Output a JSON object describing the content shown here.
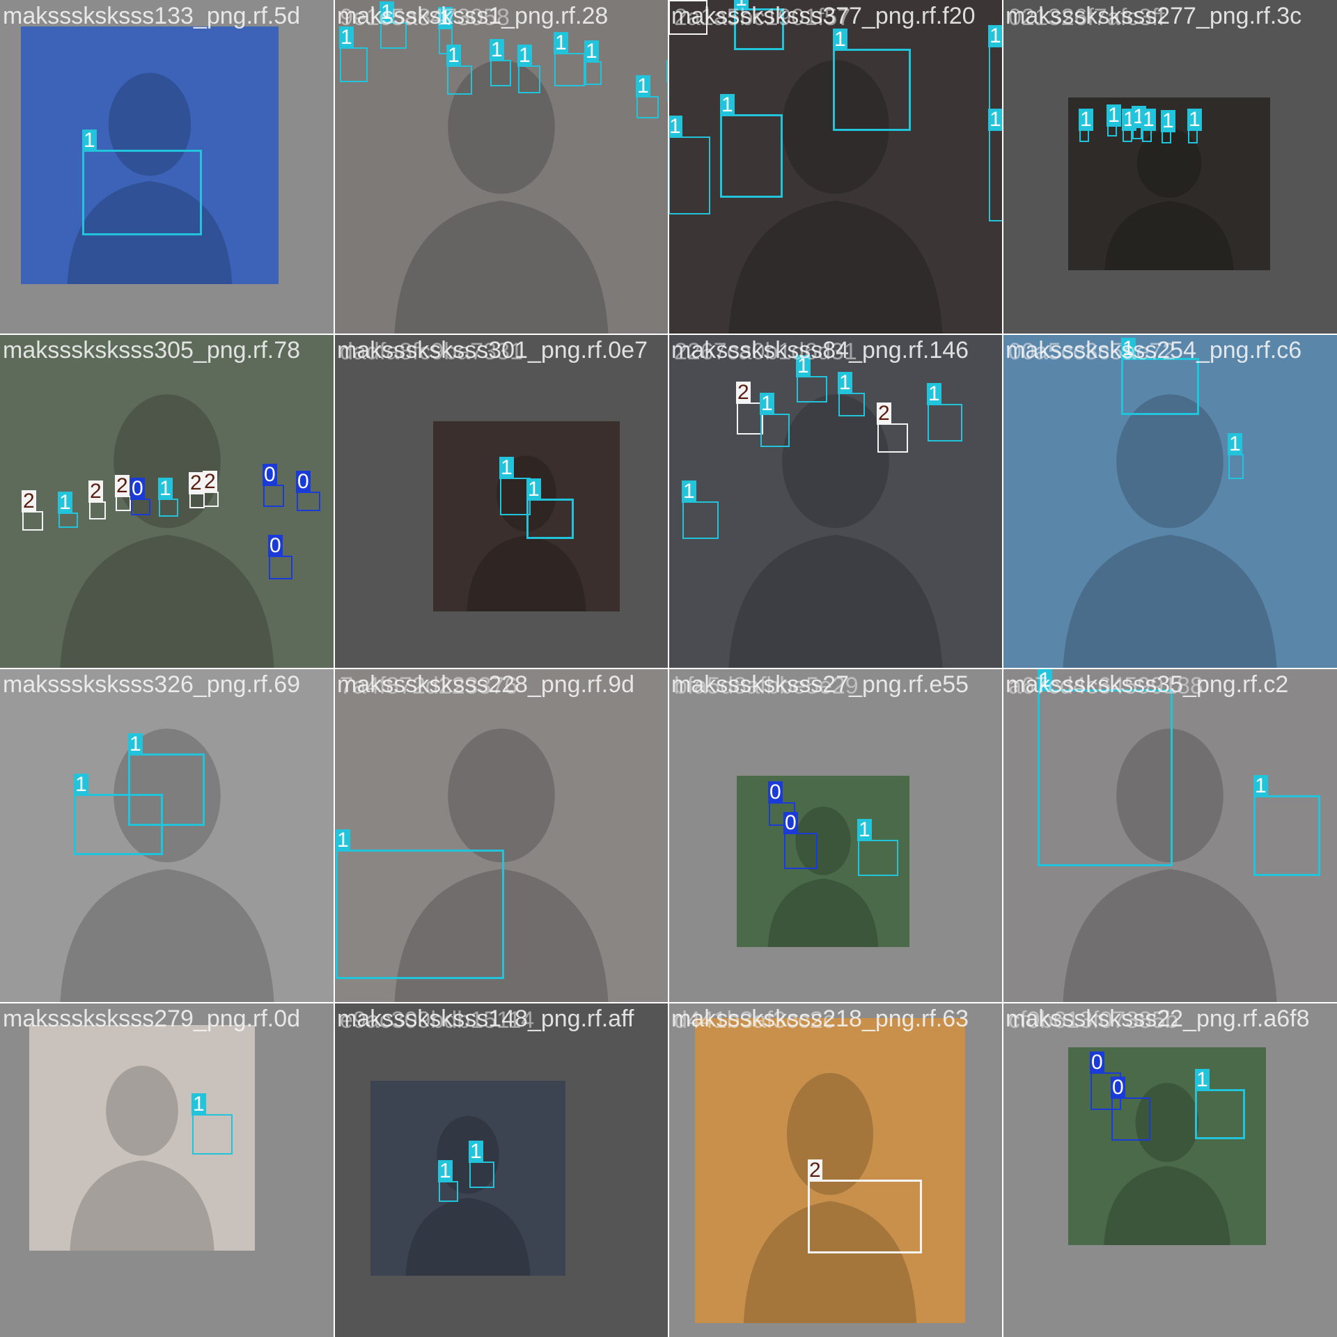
{
  "class_colors": {
    "0": "#1a3bd8",
    "1": "#22c4dc",
    "2": "#f4f4f4"
  },
  "tiles": [
    {
      "label": "maksssksksss133_png.rf.5d",
      "label2": "",
      "bg": "#8c8c8c",
      "photo": "#3c63b8",
      "boxes": [
        {
          "cls": "1"
        }
      ]
    },
    {
      "label": "maksssksksss1_png.rf.28",
      "label2": "9e1c5a8473058",
      "bg": "#6a6a6a",
      "photo": "#7d7a78",
      "boxes": [
        {
          "cls": "1"
        },
        {
          "cls": "1"
        },
        {
          "cls": "1"
        },
        {
          "cls": "1"
        },
        {
          "cls": "1"
        },
        {
          "cls": "1"
        },
        {
          "cls": "1"
        },
        {
          "cls": "1"
        },
        {
          "cls": "1"
        },
        {
          "cls": "1"
        }
      ]
    },
    {
      "label": "maksssksksss377_png.rf.f20",
      "label2": "2a1a5bc1901f57",
      "bg": "#2a2a2a",
      "photo": "#3b3535",
      "boxes": [
        {
          "cls": "2"
        },
        {
          "cls": "1"
        },
        {
          "cls": "1"
        },
        {
          "cls": "1"
        },
        {
          "cls": "1"
        },
        {
          "cls": "1"
        },
        {
          "cls": "1"
        }
      ]
    },
    {
      "label": "maksssksksss277_png.rf.3c",
      "label2": "021326f7afc3ff",
      "bg": "#555555",
      "photo": "#2e2b28",
      "boxes": [
        {
          "cls": "1"
        },
        {
          "cls": "1"
        },
        {
          "cls": "1"
        },
        {
          "cls": "1"
        },
        {
          "cls": "1"
        },
        {
          "cls": "1"
        },
        {
          "cls": "1"
        }
      ]
    },
    {
      "label": "maksssksksss305_png.rf.78",
      "label2": "",
      "bg": "#5a6458",
      "photo": "#5e6a5a",
      "boxes": [
        {
          "cls": "2"
        },
        {
          "cls": "1"
        },
        {
          "cls": "2"
        },
        {
          "cls": "2"
        },
        {
          "cls": "0"
        },
        {
          "cls": "1"
        },
        {
          "cls": "2"
        },
        {
          "cls": "2"
        },
        {
          "cls": "0"
        },
        {
          "cls": "0"
        },
        {
          "cls": "0"
        }
      ]
    },
    {
      "label": "maksssksksss301_png.rf.0e7",
      "label2": "dadfa8fc9ba7331",
      "bg": "#555555",
      "photo": "#3a2f2c",
      "boxes": [
        {
          "cls": "1"
        },
        {
          "cls": "1"
        }
      ]
    },
    {
      "label": "maksssksksss84_png.rf.146",
      "label2": "2267ca0b1d6d31",
      "bg": "#3a3c40",
      "photo": "#4a4c52",
      "boxes": [
        {
          "cls": "2"
        },
        {
          "cls": "1"
        },
        {
          "cls": "1"
        },
        {
          "cls": "1"
        },
        {
          "cls": "2"
        },
        {
          "cls": "1"
        },
        {
          "cls": "1"
        }
      ]
    },
    {
      "label": "maksssksksss254_png.rf.c6",
      "label2": "00a5cc3c5ae72",
      "bg": "#4f6f86",
      "photo": "#5a86aa",
      "boxes": [
        {
          "cls": "1"
        },
        {
          "cls": "1"
        }
      ]
    },
    {
      "label": "maksssksksss326_png.rf.69",
      "label2": "",
      "bg": "#8f8f8f",
      "photo": "#9a9a9a",
      "boxes": [
        {
          "cls": "1"
        },
        {
          "cls": "1"
        }
      ]
    },
    {
      "label": "maksssksksss228_png.rf.9d",
      "label2": "7a4f872d223376",
      "bg": "#6e6c6a",
      "photo": "#8a8684",
      "boxes": [
        {
          "cls": "1"
        }
      ]
    },
    {
      "label": "maksssksksss27_png.rf.e55",
      "label2": "bfa5d8afbbe5e29",
      "bg": "#8c8c8c",
      "photo": "#4a6a4a",
      "boxes": [
        {
          "cls": "0"
        },
        {
          "cls": "0"
        },
        {
          "cls": "1"
        }
      ]
    },
    {
      "label": "maksssksksss35_png.rf.c2",
      "label2": "a67cd4c64599188",
      "bg": "#777777",
      "photo": "#8a8888",
      "boxes": [
        {
          "cls": "1"
        },
        {
          "cls": "1"
        }
      ]
    },
    {
      "label": "maksssksksss279_png.rf.0d",
      "label2": "",
      "bg": "#8c8c8c",
      "photo": "#c9c2bc",
      "boxes": [
        {
          "cls": "1"
        }
      ]
    },
    {
      "label": "maksssksksss148_png.rf.aff",
      "label2": "e9ac309bdb15114",
      "bg": "#555555",
      "photo": "#3c4452",
      "boxes": [
        {
          "cls": "1"
        },
        {
          "cls": "1"
        }
      ]
    },
    {
      "label": "maksssksksss218_png.rf.63",
      "label2": "d441b3af3cc2c",
      "bg": "#8c8c8c",
      "photo": "#c8904a",
      "boxes": [
        {
          "cls": "2"
        }
      ]
    },
    {
      "label": "maksssksksss22_png.rf.a6f8",
      "label2": "cf0b613f07385b",
      "bg": "#8c8c8c",
      "photo": "#4a6a4a",
      "boxes": [
        {
          "cls": "0"
        },
        {
          "cls": "0"
        },
        {
          "cls": "1"
        }
      ]
    }
  ]
}
